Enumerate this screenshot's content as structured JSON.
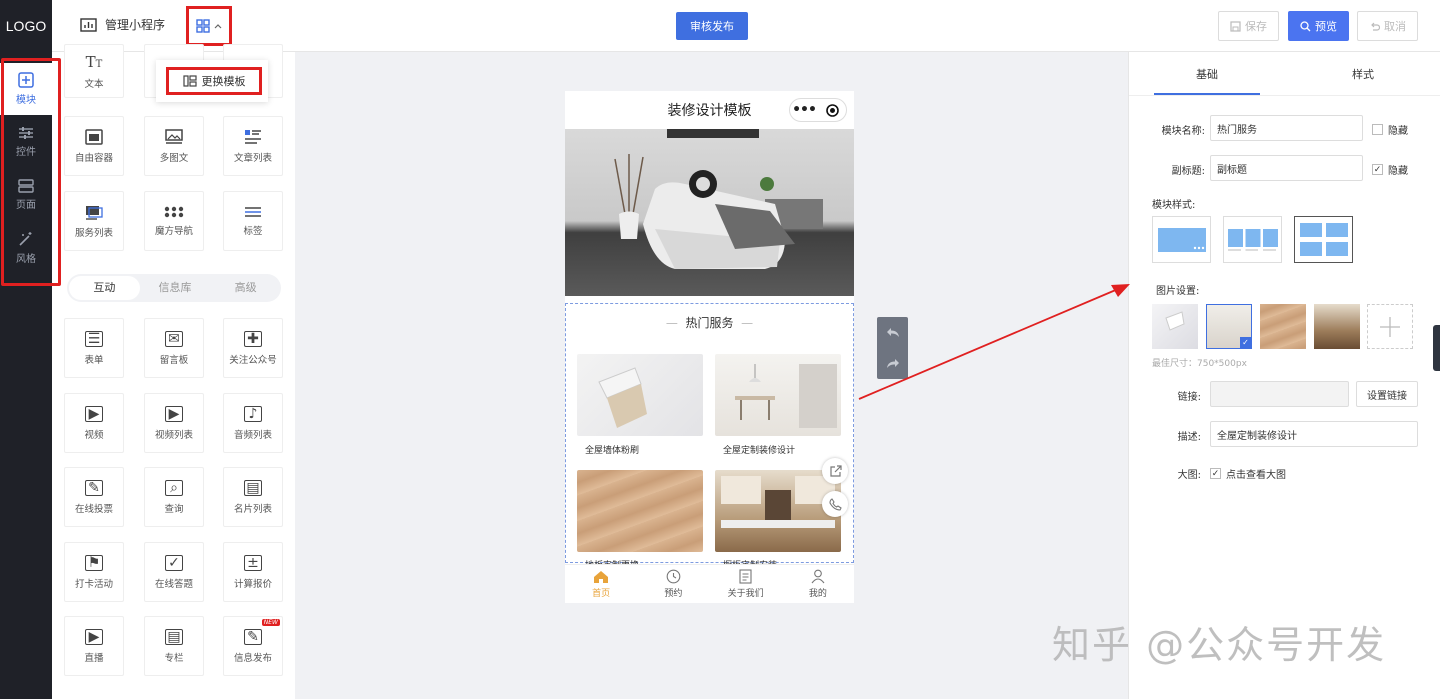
{
  "header": {
    "logo": "LOGO",
    "manage_label": "管理小程序",
    "publish_label": "审核发布",
    "save_label": "保存",
    "preview_label": "预览",
    "cancel_label": "取消"
  },
  "rail": {
    "items": [
      {
        "label": "模块",
        "icon": "plus-square-icon"
      },
      {
        "label": "控件",
        "icon": "sliders-icon"
      },
      {
        "label": "页面",
        "icon": "pages-icon"
      },
      {
        "label": "风格",
        "icon": "magic-wand-icon"
      }
    ]
  },
  "popup": {
    "label": "更换模板"
  },
  "panel": {
    "basic_tiles": [
      {
        "label": "文本",
        "icon": "text-icon"
      },
      {
        "label": "自由容器",
        "icon": "container-icon"
      },
      {
        "label": "多图文",
        "icon": "image-text-icon"
      },
      {
        "label": "文章列表",
        "icon": "article-list-icon"
      },
      {
        "label": "服务列表",
        "icon": "service-list-icon"
      },
      {
        "label": "魔方导航",
        "icon": "cube-nav-icon"
      },
      {
        "label": "标签",
        "icon": "tags-icon"
      }
    ],
    "segments": [
      "互动",
      "信息库",
      "高级"
    ],
    "interactive_tiles": [
      {
        "label": "表单",
        "icon": "form-icon"
      },
      {
        "label": "留言板",
        "icon": "message-board-icon"
      },
      {
        "label": "关注公众号",
        "icon": "follow-user-icon"
      },
      {
        "label": "视频",
        "icon": "video-icon"
      },
      {
        "label": "视频列表",
        "icon": "video-list-icon"
      },
      {
        "label": "音频列表",
        "icon": "audio-list-icon"
      },
      {
        "label": "在线投票",
        "icon": "vote-icon"
      },
      {
        "label": "查询",
        "icon": "query-icon"
      },
      {
        "label": "名片列表",
        "icon": "card-list-icon"
      },
      {
        "label": "打卡活动",
        "icon": "checkin-flag-icon"
      },
      {
        "label": "在线答题",
        "icon": "quiz-icon"
      },
      {
        "label": "计算报价",
        "icon": "calculator-icon"
      },
      {
        "label": "直播",
        "icon": "live-tv-icon"
      },
      {
        "label": "专栏",
        "icon": "column-icon"
      },
      {
        "label": "信息发布",
        "icon": "info-publish-icon",
        "badge": "NEW"
      }
    ]
  },
  "phone": {
    "title": "装修设计模板",
    "section_title": "热门服务",
    "cards": [
      "全屋墙体粉刷",
      "全屋定制装修设计",
      "地板定制更换",
      "橱柜定制安装"
    ],
    "tabs": [
      {
        "label": "首页",
        "icon": "home-icon"
      },
      {
        "label": "预约",
        "icon": "clock-icon"
      },
      {
        "label": "关于我们",
        "icon": "doc-icon"
      },
      {
        "label": "我的",
        "icon": "user-icon"
      }
    ]
  },
  "right": {
    "tabs": [
      "基础",
      "样式"
    ],
    "name_label": "模块名称:",
    "name_value": "热门服务",
    "subtitle_label": "副标题:",
    "subtitle_value": "副标题",
    "hide_label": "隐藏",
    "name_hidden": false,
    "subtitle_hidden": true,
    "style_label": "模块样式:",
    "image_label": "图片设置:",
    "size_hint": "最佳尺寸：750*500px",
    "link_label": "链接:",
    "link_value": "",
    "set_link_label": "设置链接",
    "desc_label": "描述:",
    "desc_value": "全屋定制装修设计",
    "bigimg_label": "大图:",
    "bigimg_check": "点击查看大图",
    "bigimg_checked": true
  },
  "watermark": "知乎 @公众号开发"
}
